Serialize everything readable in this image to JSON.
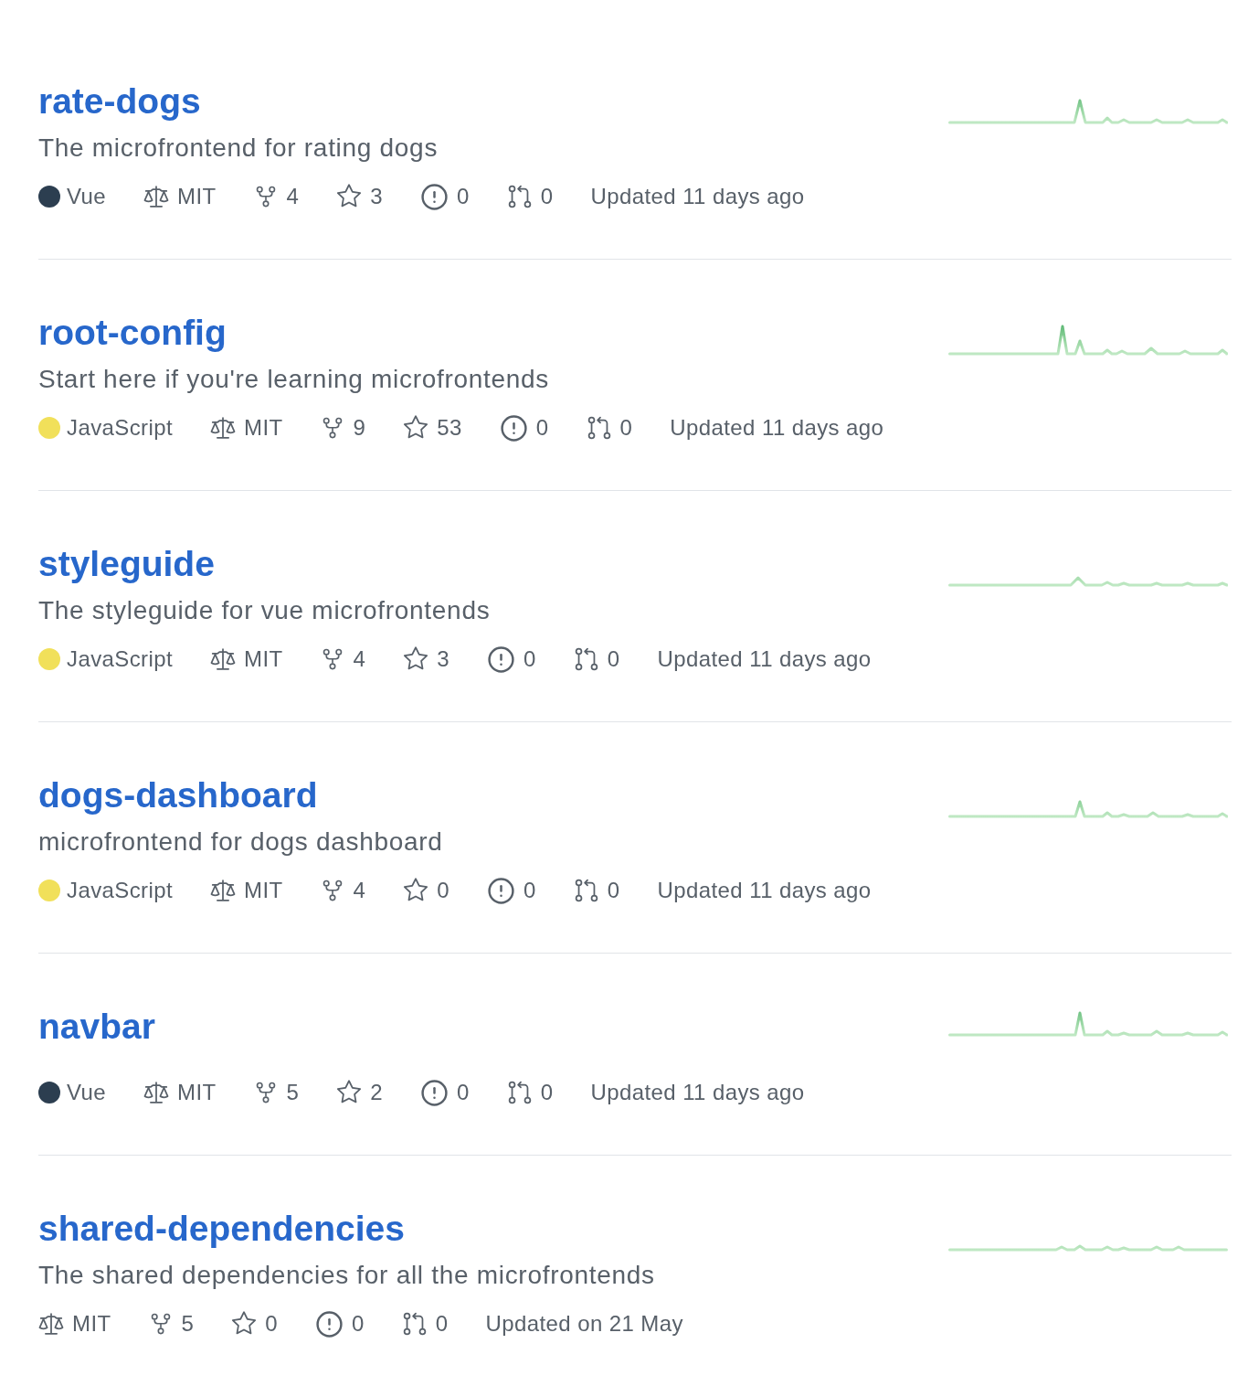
{
  "repositories": [
    {
      "name": "rate-dogs",
      "description": "The microfrontend for rating dogs",
      "language": {
        "name": "Vue",
        "color": "#2c3e50"
      },
      "license": "MIT",
      "forks": "4",
      "stars": "3",
      "issues": "0",
      "pull_requests": "0",
      "updated": "Updated 11 days ago"
    },
    {
      "name": "root-config",
      "description": "Start here if you're learning microfrontends",
      "language": {
        "name": "JavaScript",
        "color": "#f1e05a"
      },
      "license": "MIT",
      "forks": "9",
      "stars": "53",
      "issues": "0",
      "pull_requests": "0",
      "updated": "Updated 11 days ago"
    },
    {
      "name": "styleguide",
      "description": "The styleguide for vue microfrontends",
      "language": {
        "name": "JavaScript",
        "color": "#f1e05a"
      },
      "license": "MIT",
      "forks": "4",
      "stars": "3",
      "issues": "0",
      "pull_requests": "0",
      "updated": "Updated 11 days ago"
    },
    {
      "name": "dogs-dashboard",
      "description": "microfrontend for dogs dashboard",
      "language": {
        "name": "JavaScript",
        "color": "#f1e05a"
      },
      "license": "MIT",
      "forks": "4",
      "stars": "0",
      "issues": "0",
      "pull_requests": "0",
      "updated": "Updated 11 days ago"
    },
    {
      "name": "navbar",
      "language": {
        "name": "Vue",
        "color": "#2c3e50"
      },
      "license": "MIT",
      "forks": "5",
      "stars": "2",
      "issues": "0",
      "pull_requests": "0",
      "updated": "Updated 11 days ago"
    },
    {
      "name": "shared-dependencies",
      "description": "The shared dependencies for all the microfrontends",
      "license": "MIT",
      "forks": "5",
      "stars": "0",
      "issues": "0",
      "pull_requests": "0",
      "updated": "Updated on 21 May"
    }
  ]
}
